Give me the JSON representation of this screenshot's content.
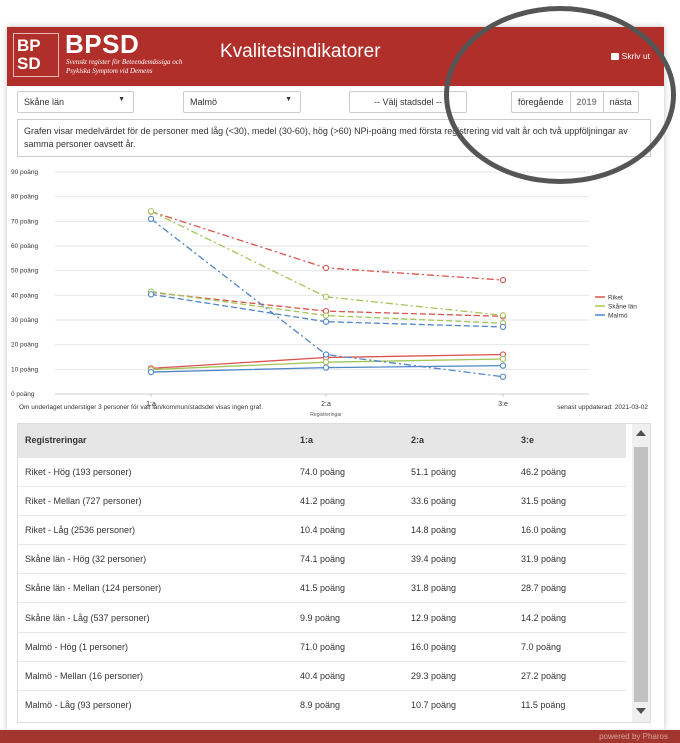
{
  "header": {
    "logo_line1": "BP",
    "logo_line2": "SD",
    "brand": "BPSD",
    "brand_sub_line1": "Svenskt register för Beteendemässiga och",
    "brand_sub_line2": "Psykiska Symptom vid Demens",
    "title": "Kvalitetsindikatorer",
    "print_label": "Skriv ut"
  },
  "filters": {
    "county": "Skåne län",
    "municipality": "Malmö",
    "district": "-- Välj stadsdel --",
    "prev_label": "föregående",
    "year": "2019",
    "next_label": "nästa"
  },
  "description": "Grafen visar medelvärdet för de personer med låg (<30), medel (30-60), hög (>60) NPi-poäng med första registrering vid valt år och två uppföljningar av samma personer oavsett år.",
  "chart_data": {
    "type": "line",
    "categories": [
      "1:a",
      "2:a",
      "3:e"
    ],
    "xlabel": "Registreringar",
    "ylabel": "",
    "ylim": [
      0,
      90
    ],
    "yticks": [
      "0 poäng",
      "10 poäng",
      "20 poäng",
      "30 poäng",
      "40 poäng",
      "50 poäng",
      "60 poäng",
      "70 poäng",
      "80 poäng",
      "90 poäng"
    ],
    "legend": [
      "Riket",
      "Skåne län",
      "Malmö"
    ],
    "legend_position": "right",
    "colors": {
      "Riket": "#d9534f",
      "Skåne län": "#a3c55a",
      "Malmö": "#4f86c6"
    },
    "series": [
      {
        "name": "Riket - Hög",
        "group": "Riket",
        "dash": "dashdot",
        "values": [
          74.0,
          51.1,
          46.2
        ]
      },
      {
        "name": "Riket - Mellan",
        "group": "Riket",
        "dash": "dash",
        "values": [
          41.2,
          33.6,
          31.5
        ]
      },
      {
        "name": "Riket - Låg",
        "group": "Riket",
        "dash": "solid",
        "values": [
          10.4,
          14.8,
          16.0
        ]
      },
      {
        "name": "Skåne län - Hög",
        "group": "Skåne län",
        "dash": "dashdot",
        "values": [
          74.1,
          39.4,
          31.9
        ]
      },
      {
        "name": "Skåne län - Mellan",
        "group": "Skåne län",
        "dash": "dash",
        "values": [
          41.5,
          31.8,
          28.7
        ]
      },
      {
        "name": "Skåne län - Låg",
        "group": "Skåne län",
        "dash": "solid",
        "values": [
          9.9,
          12.9,
          14.2
        ]
      },
      {
        "name": "Malmö - Hög",
        "group": "Malmö",
        "dash": "dashdot",
        "values": [
          71.0,
          16.0,
          7.0
        ]
      },
      {
        "name": "Malmö - Mellan",
        "group": "Malmö",
        "dash": "dash",
        "values": [
          40.4,
          29.3,
          27.2
        ]
      },
      {
        "name": "Malmö - Låg",
        "group": "Malmö",
        "dash": "solid",
        "values": [
          8.9,
          10.7,
          11.5
        ]
      }
    ]
  },
  "notes": {
    "footnote": "Om underlaget understiger 3 personer för valt län/kommun/stadsdel visas ingen graf.",
    "updated": "senast uppdaterad: 2021-03-02"
  },
  "table": {
    "headers": [
      "Registreringar",
      "1:a",
      "2:a",
      "3:e"
    ],
    "rows": [
      [
        "Riket - Hög (193 personer)",
        "74.0 poäng",
        "51.1 poäng",
        "46.2 poäng"
      ],
      [
        "Riket - Mellan (727 personer)",
        "41.2 poäng",
        "33.6 poäng",
        "31.5 poäng"
      ],
      [
        "Riket - Låg (2536 personer)",
        "10.4 poäng",
        "14.8 poäng",
        "16.0 poäng"
      ],
      [
        "Skåne län - Hög (32 personer)",
        "74.1 poäng",
        "39.4 poäng",
        "31.9 poäng"
      ],
      [
        "Skåne län - Mellan (124 personer)",
        "41.5 poäng",
        "31.8 poäng",
        "28.7 poäng"
      ],
      [
        "Skåne län - Låg (537 personer)",
        "9.9 poäng",
        "12.9 poäng",
        "14.2 poäng"
      ],
      [
        "Malmö - Hög (1 personer)",
        "71.0 poäng",
        "16.0 poäng",
        "7.0 poäng"
      ],
      [
        "Malmö - Mellan (16 personer)",
        "40.4 poäng",
        "29.3 poäng",
        "27.2 poäng"
      ],
      [
        "Malmö - Låg (93 personer)",
        "8.9 poäng",
        "10.7 poäng",
        "11.5 poäng"
      ]
    ]
  },
  "footer": {
    "powered": "powered by Pharos"
  }
}
